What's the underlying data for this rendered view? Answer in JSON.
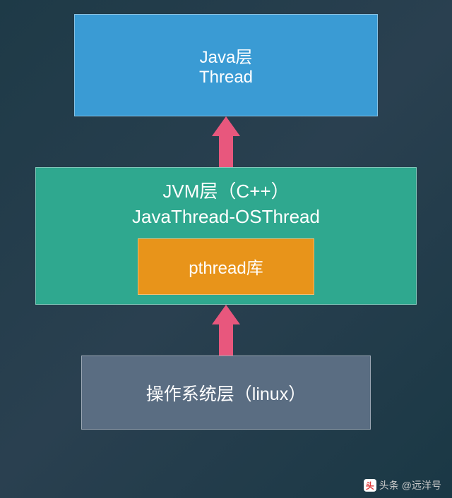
{
  "layers": {
    "java": {
      "title": "Java层",
      "subtitle": "Thread"
    },
    "jvm": {
      "title": "JVM层（C++）",
      "subtitle": "JavaThread-OSThread",
      "inner": "pthread库"
    },
    "os": {
      "title": "操作系统层（linux）"
    }
  },
  "watermark": {
    "prefix": "头条",
    "author": "@远洋号"
  }
}
